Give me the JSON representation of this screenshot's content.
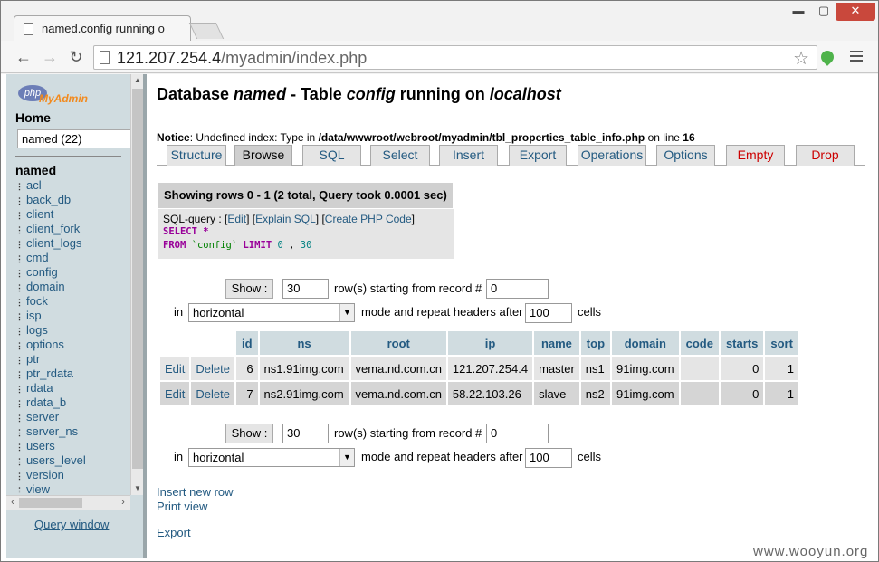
{
  "browser": {
    "tab_title": "named.config running o",
    "url_host": "121.207.254.4",
    "url_path": "/myadmin/index.php",
    "window_buttons": {
      "minimize": "▬",
      "maximize": "▢",
      "close": "✕"
    }
  },
  "sidebar": {
    "logo_php": "php",
    "logo_myadmin": "MyAdmin",
    "home": "Home",
    "db_select": "named (22)",
    "db_name": "named",
    "tables": [
      "acl",
      "back_db",
      "client",
      "client_fork",
      "client_logs",
      "cmd",
      "config",
      "domain",
      "fock",
      "isp",
      "logs",
      "options",
      "ptr",
      "ptr_rdata",
      "rdata",
      "rdata_b",
      "server",
      "server_ns",
      "users",
      "users_level",
      "version",
      "view"
    ],
    "query_window": "Query window"
  },
  "main": {
    "title_prefix": "Database ",
    "title_db": "named",
    "title_mid": " - Table ",
    "title_table": "config",
    "title_suffix": " running on ",
    "title_host": "localhost",
    "notice_label": "Notice",
    "notice_text": ": Undefined index: Type in ",
    "notice_path": "/data/wwwroot/webroot/myadmin/tbl_properties_table_info.php",
    "notice_line_text": " on line ",
    "notice_line": "16",
    "tabs": {
      "structure": "Structure",
      "browse": "Browse",
      "sql": "SQL",
      "select": "Select",
      "insert": "Insert",
      "export": "Export",
      "operations": "Operations",
      "options": "Options",
      "empty": "Empty",
      "drop": "Drop"
    },
    "showing": "Showing rows 0 - 1 (2 total, Query took 0.0001 sec)",
    "sql_query_label": "SQL-query : ",
    "sql_edit": "Edit",
    "sql_explain": "Explain SQL",
    "sql_php": "Create PHP Code",
    "sql_select": "SELECT",
    "sql_star": " *",
    "sql_from": "FROM",
    "sql_table": "`config`",
    "sql_limit": "LIMIT",
    "sql_offset": "0",
    "sql_comma": " , ",
    "sql_count": "30",
    "nav": {
      "show_button": "Show :",
      "rows_value": "30",
      "rows_label": "row(s) starting from record #",
      "start_value": "0",
      "in_label": "in",
      "mode_value": "horizontal",
      "repeat_label": "mode and repeat headers after",
      "repeat_value": "100",
      "cells_label": "cells"
    },
    "columns": [
      "id",
      "ns",
      "root",
      "ip",
      "name",
      "top",
      "domain",
      "code",
      "starts",
      "sort"
    ],
    "row_actions": {
      "edit": "Edit",
      "delete": "Delete"
    },
    "rows": [
      [
        "6",
        "ns1.91img.com",
        "vema.nd.com.cn",
        "121.207.254.4",
        "master",
        "ns1",
        "91img.com",
        "",
        "0",
        "1"
      ],
      [
        "7",
        "ns2.91img.com",
        "vema.nd.com.cn",
        "58.22.103.26",
        "slave",
        "ns2",
        "91img.com",
        "",
        "0",
        "1"
      ]
    ],
    "insert_link": "Insert new row",
    "print_link": "Print view",
    "export_link": "Export"
  },
  "watermark": "www.wooyun.org"
}
